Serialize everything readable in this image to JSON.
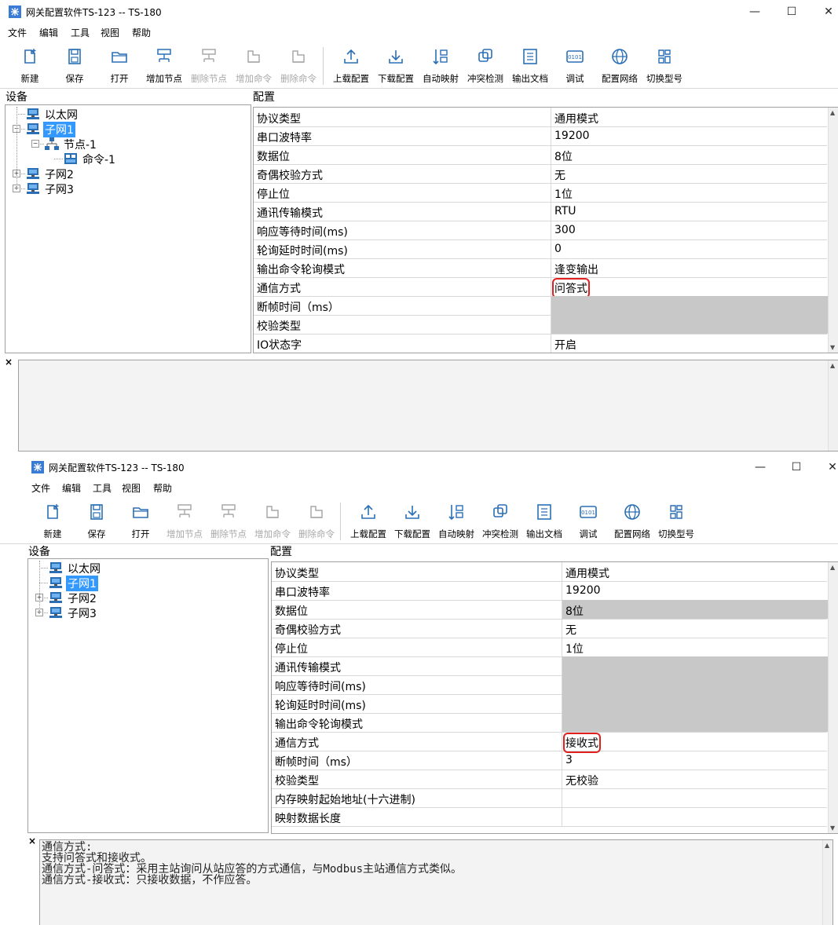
{
  "window1": {
    "title": "网关配置软件TS-123 -- TS-180",
    "menu": [
      "文件",
      "编辑",
      "工具",
      "视图",
      "帮助"
    ],
    "toolbar": [
      {
        "label": "新建",
        "icon": "new-file-icon",
        "enabled": true
      },
      {
        "label": "保存",
        "icon": "save-icon",
        "enabled": true
      },
      {
        "label": "打开",
        "icon": "folder-open-icon",
        "enabled": true
      },
      {
        "label": "增加节点",
        "icon": "add-node-icon",
        "enabled": true
      },
      {
        "label": "删除节点",
        "icon": "delete-node-icon",
        "enabled": false
      },
      {
        "label": "增加命令",
        "icon": "add-command-icon",
        "enabled": false
      },
      {
        "label": "删除命令",
        "icon": "delete-command-icon",
        "enabled": false
      },
      {
        "label": "上载配置",
        "icon": "upload-icon",
        "enabled": true
      },
      {
        "label": "下载配置",
        "icon": "download-icon",
        "enabled": true
      },
      {
        "label": "自动映射",
        "icon": "auto-map-icon",
        "enabled": true
      },
      {
        "label": "冲突检测",
        "icon": "conflict-check-icon",
        "enabled": true
      },
      {
        "label": "输出文档",
        "icon": "export-doc-icon",
        "enabled": true
      },
      {
        "label": "调试",
        "icon": "debug-icon",
        "enabled": true
      },
      {
        "label": "配置网络",
        "icon": "globe-icon",
        "enabled": true
      },
      {
        "label": "切换型号",
        "icon": "switch-model-icon",
        "enabled": true
      }
    ],
    "device_header": "设备",
    "config_header": "配置",
    "tree": [
      {
        "label": "以太网",
        "level": 0,
        "icon": "network-icon"
      },
      {
        "label": "子网1",
        "level": 0,
        "icon": "network-icon",
        "selected": true,
        "expanded": true
      },
      {
        "label": "节点-1",
        "level": 1,
        "icon": "node-icon",
        "expanded": true
      },
      {
        "label": "命令-1",
        "level": 2,
        "icon": "command-icon"
      },
      {
        "label": "子网2",
        "level": 0,
        "icon": "network-icon",
        "collapsed": true
      },
      {
        "label": "子网3",
        "level": 0,
        "icon": "network-icon",
        "collapsed": true
      }
    ],
    "rows": [
      {
        "name": "协议类型",
        "value": "通用模式"
      },
      {
        "name": "串口波特率",
        "value": "19200"
      },
      {
        "name": "数据位",
        "value": "8位"
      },
      {
        "name": "奇偶校验方式",
        "value": "无"
      },
      {
        "name": "停止位",
        "value": "1位"
      },
      {
        "name": "通讯传输模式",
        "value": "RTU"
      },
      {
        "name": "响应等待时间(ms)",
        "value": "300"
      },
      {
        "name": "轮询延时时间(ms)",
        "value": "0"
      },
      {
        "name": "输出命令轮询模式",
        "value": "逢变输出"
      },
      {
        "name": "通信方式",
        "value": "问答式",
        "highlight": true
      },
      {
        "name": "断帧时间（ms）",
        "value": "",
        "gray": true
      },
      {
        "name": "校验类型",
        "value": "",
        "gray": true
      },
      {
        "name": "IO状态字",
        "value": "开启"
      }
    ],
    "description": []
  },
  "window2": {
    "title": "网关配置软件TS-123 -- TS-180",
    "menu": [
      "文件",
      "编辑",
      "工具",
      "视图",
      "帮助"
    ],
    "toolbar": [
      {
        "label": "新建",
        "icon": "new-file-icon",
        "enabled": true
      },
      {
        "label": "保存",
        "icon": "save-icon",
        "enabled": true
      },
      {
        "label": "打开",
        "icon": "folder-open-icon",
        "enabled": true
      },
      {
        "label": "增加节点",
        "icon": "add-node-icon",
        "enabled": false
      },
      {
        "label": "删除节点",
        "icon": "delete-node-icon",
        "enabled": false
      },
      {
        "label": "增加命令",
        "icon": "add-command-icon",
        "enabled": false
      },
      {
        "label": "删除命令",
        "icon": "delete-command-icon",
        "enabled": false
      },
      {
        "label": "上载配置",
        "icon": "upload-icon",
        "enabled": true
      },
      {
        "label": "下载配置",
        "icon": "download-icon",
        "enabled": true
      },
      {
        "label": "自动映射",
        "icon": "auto-map-icon",
        "enabled": true
      },
      {
        "label": "冲突检测",
        "icon": "conflict-check-icon",
        "enabled": true
      },
      {
        "label": "输出文档",
        "icon": "export-doc-icon",
        "enabled": true
      },
      {
        "label": "调试",
        "icon": "debug-icon",
        "enabled": true
      },
      {
        "label": "配置网络",
        "icon": "globe-icon",
        "enabled": true
      },
      {
        "label": "切换型号",
        "icon": "switch-model-icon",
        "enabled": true
      }
    ],
    "device_header": "设备",
    "config_header": "配置",
    "tree": [
      {
        "label": "以太网",
        "level": 0,
        "icon": "network-icon"
      },
      {
        "label": "子网1",
        "level": 0,
        "icon": "network-icon",
        "selected": true
      },
      {
        "label": "子网2",
        "level": 0,
        "icon": "network-icon",
        "collapsed": true
      },
      {
        "label": "子网3",
        "level": 0,
        "icon": "network-icon",
        "collapsed": true
      }
    ],
    "rows": [
      {
        "name": "协议类型",
        "value": "通用模式"
      },
      {
        "name": "串口波特率",
        "value": "19200"
      },
      {
        "name": "数据位",
        "value": "8位",
        "gray": true
      },
      {
        "name": "奇偶校验方式",
        "value": "无"
      },
      {
        "name": "停止位",
        "value": "1位"
      },
      {
        "name": "通讯传输模式",
        "value": "",
        "gray": true
      },
      {
        "name": "响应等待时间(ms)",
        "value": "",
        "gray": true
      },
      {
        "name": "轮询延时时间(ms)",
        "value": "",
        "gray": true
      },
      {
        "name": "输出命令轮询模式",
        "value": "",
        "gray": true
      },
      {
        "name": "通信方式",
        "value": "接收式",
        "highlight": true
      },
      {
        "name": "断帧时间（ms）",
        "value": "3"
      },
      {
        "name": "校验类型",
        "value": "无校验"
      },
      {
        "name": "内存映射起始地址(十六进制)",
        "value": ""
      },
      {
        "name": "映射数据长度",
        "value": ""
      }
    ],
    "description": [
      "通信方式:",
      "支持问答式和接收式。",
      "通信方式-问答式：采用主站询问从站应答的方式通信，与Modbus主站通信方式类似。",
      "通信方式-接收式：只接收数据，不作应答。"
    ]
  },
  "colors": {
    "selection": "#3399ff",
    "highlight_border": "#e0201f",
    "gray_cell": "#c8c8c8",
    "icon": "#2a6fb5"
  }
}
